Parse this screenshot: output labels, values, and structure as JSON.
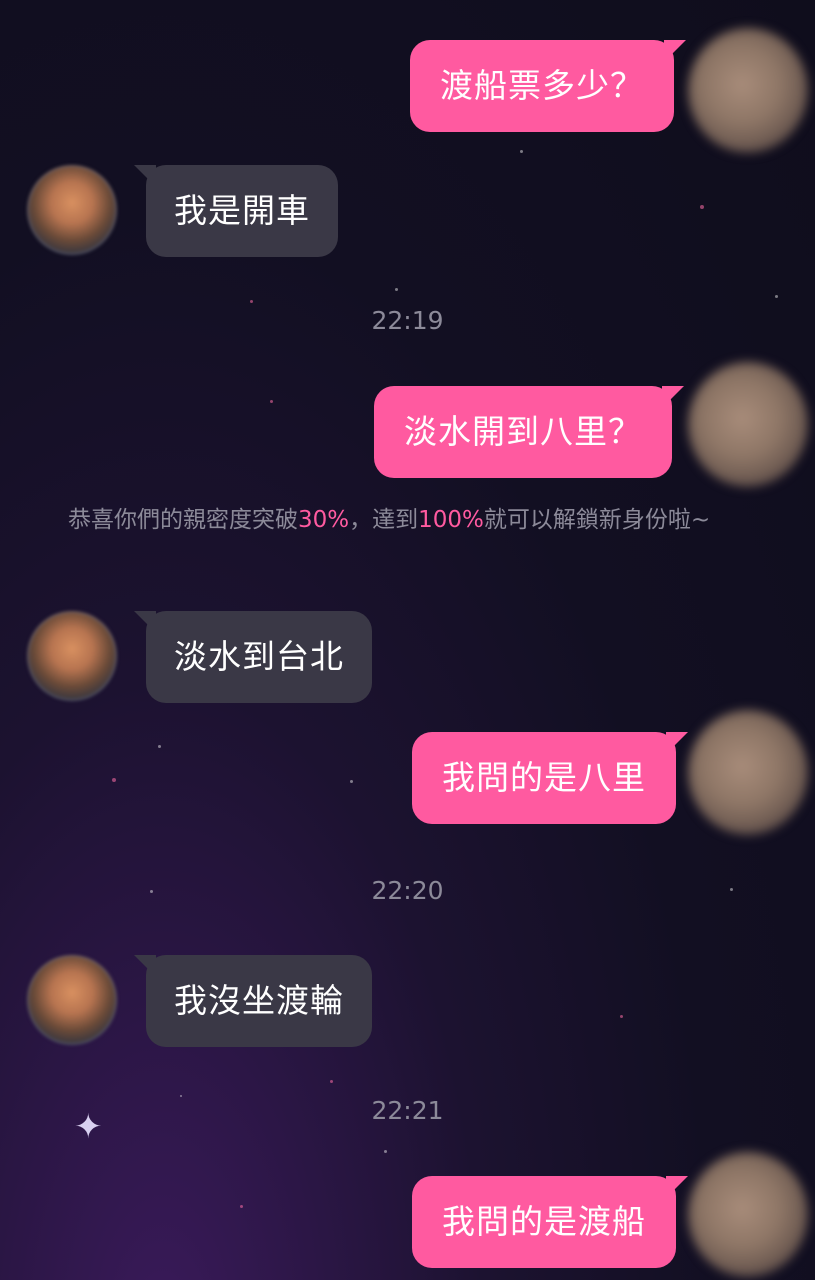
{
  "colors": {
    "outgoing_bubble": "#ff5aa0",
    "incoming_bubble": "#3a3846",
    "timestamp_text": "#8c8a99",
    "highlight": "#ff5aa0"
  },
  "messages": [
    {
      "side": "out",
      "text": "渡船票多少？"
    },
    {
      "side": "in",
      "text": "我是開車"
    },
    {
      "side": "out",
      "text": "淡水開到八里？"
    },
    {
      "side": "in",
      "text": "淡水到台北"
    },
    {
      "side": "out",
      "text": "我問的是八里"
    },
    {
      "side": "in",
      "text": "我沒坐渡輪"
    },
    {
      "side": "out",
      "text": "我問的是渡船"
    }
  ],
  "timestamps": [
    "22:19",
    "22:20",
    "22:21"
  ],
  "intimacy_notice": {
    "prefix": "恭喜你們的親密度突破",
    "current_percent": "30%",
    "middle": "，達到",
    "target_percent": "100%",
    "suffix": "就可以解鎖新身份啦~"
  },
  "icons": {
    "contact_avatar": "avatar-icon",
    "self_avatar": "avatar-icon",
    "background_sparkle": "sparkle-icon"
  }
}
